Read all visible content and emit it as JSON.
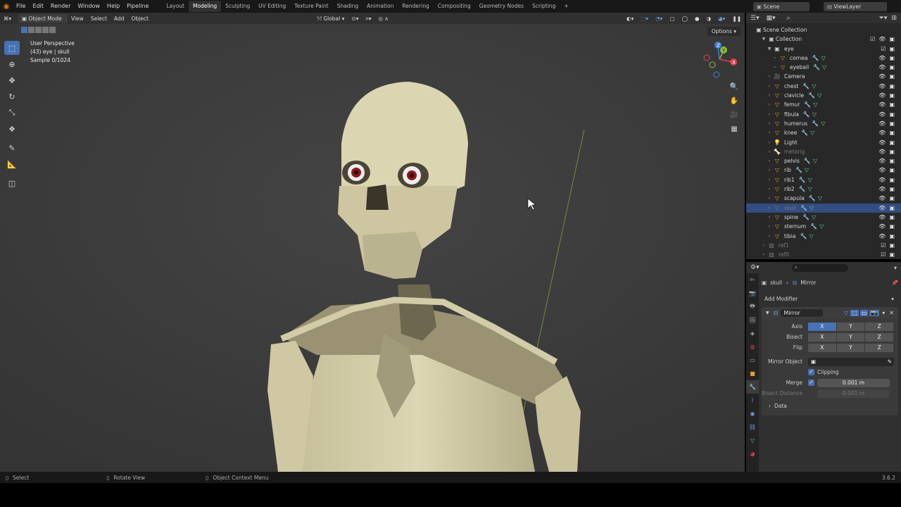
{
  "menubar": {
    "items": [
      "File",
      "Edit",
      "Render",
      "Window",
      "Help",
      "Pipeline"
    ],
    "workspaces": [
      "Layout",
      "Modeling",
      "Sculpting",
      "UV Editing",
      "Texture Paint",
      "Shading",
      "Animation",
      "Rendering",
      "Compositing",
      "Geometry Nodes",
      "Scripting"
    ],
    "active_workspace": "Modeling",
    "add_tab": "+",
    "scene_label": "Scene",
    "viewlayer_label": "ViewLayer"
  },
  "viewport_header": {
    "mode": "Object Mode",
    "menus": [
      "View",
      "Select",
      "Add",
      "Object"
    ],
    "transform_orientation": "Global",
    "options_label": "Options"
  },
  "viewport": {
    "info_line1": "User Perspective",
    "info_line2": "(43) eye | skull",
    "info_line3": "Sample 0/1024",
    "gizmo_axes": [
      "X",
      "Y",
      "Z"
    ]
  },
  "outliner": {
    "scene_collection": "Scene Collection",
    "collection": "Collection",
    "items": [
      {
        "label": "eye",
        "level": 2,
        "kind": "collection"
      },
      {
        "label": "cornea",
        "level": 3,
        "kind": "mesh"
      },
      {
        "label": "eyeball",
        "level": 3,
        "kind": "mesh"
      },
      {
        "label": "Camera",
        "level": 2,
        "kind": "camera"
      },
      {
        "label": "chest",
        "level": 2,
        "kind": "mesh"
      },
      {
        "label": "clavicle",
        "level": 2,
        "kind": "mesh"
      },
      {
        "label": "femur",
        "level": 2,
        "kind": "mesh"
      },
      {
        "label": "fibula",
        "level": 2,
        "kind": "mesh"
      },
      {
        "label": "humerus",
        "level": 2,
        "kind": "mesh"
      },
      {
        "label": "knee",
        "level": 2,
        "kind": "mesh"
      },
      {
        "label": "Light",
        "level": 2,
        "kind": "light"
      },
      {
        "label": "metarig",
        "level": 2,
        "kind": "armature",
        "dim": true
      },
      {
        "label": "pelvis",
        "level": 2,
        "kind": "mesh"
      },
      {
        "label": "rib",
        "level": 2,
        "kind": "mesh"
      },
      {
        "label": "rib1",
        "level": 2,
        "kind": "mesh"
      },
      {
        "label": "rib2",
        "level": 2,
        "kind": "mesh"
      },
      {
        "label": "scapula",
        "level": 2,
        "kind": "mesh"
      },
      {
        "label": "skull",
        "level": 2,
        "kind": "mesh",
        "selected": true,
        "dim": true
      },
      {
        "label": "spine",
        "level": 2,
        "kind": "mesh"
      },
      {
        "label": "sternum",
        "level": 2,
        "kind": "mesh"
      },
      {
        "label": "tibia",
        "level": 2,
        "kind": "mesh"
      },
      {
        "label": "ref1",
        "level": 1,
        "kind": "image",
        "dim": true
      },
      {
        "label": "ref0",
        "level": 1,
        "kind": "image",
        "dim": true
      }
    ]
  },
  "properties": {
    "breadcrumb_object": "skull",
    "breadcrumb_modifier": "Mirror",
    "add_modifier": "Add Modifier",
    "modifier_name": "Mirror",
    "axis_label": "Axis",
    "bisect_label": "Bisect",
    "flip_label": "Flip",
    "x": "X",
    "y": "Y",
    "z": "Z",
    "mirror_object_label": "Mirror Object",
    "clipping_label": "Clipping",
    "merge_label": "Merge",
    "merge_value": "0.001 m",
    "bisect_distance_label": "Bisect Distance",
    "bisect_distance_value": "0.001 m",
    "data_label": "Data"
  },
  "statusbar": {
    "select": "Select",
    "rotate": "Rotate View",
    "context": "Object Context Menu",
    "version": "3.6.2"
  },
  "colors": {
    "accent": "#4772b3",
    "selection_row": "#334d80",
    "viewport_bg": "#3d3d3d",
    "bone": "#cfc9a4"
  }
}
